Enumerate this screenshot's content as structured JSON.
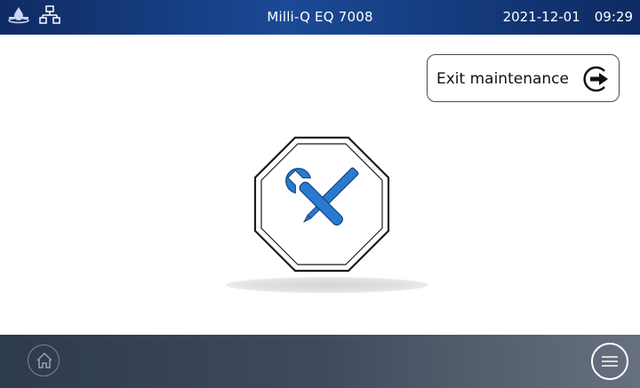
{
  "header": {
    "title": "Milli-Q EQ 7008",
    "date": "2021-12-01",
    "time": "09:29",
    "icons": [
      "water-drop-icon",
      "network-icon"
    ]
  },
  "actions": {
    "exit_maintenance_label": "Exit maintenance",
    "exit_icon": "exit-arrow-icon"
  },
  "main": {
    "graphic": "maintenance-tools-icon"
  },
  "footer": {
    "home_icon": "home-icon",
    "menu_icon": "menu-icon"
  },
  "colors": {
    "header_bg": "#1b4a96",
    "accent_blue": "#2a7ad1",
    "footer_bg": "#3f4b5d"
  }
}
